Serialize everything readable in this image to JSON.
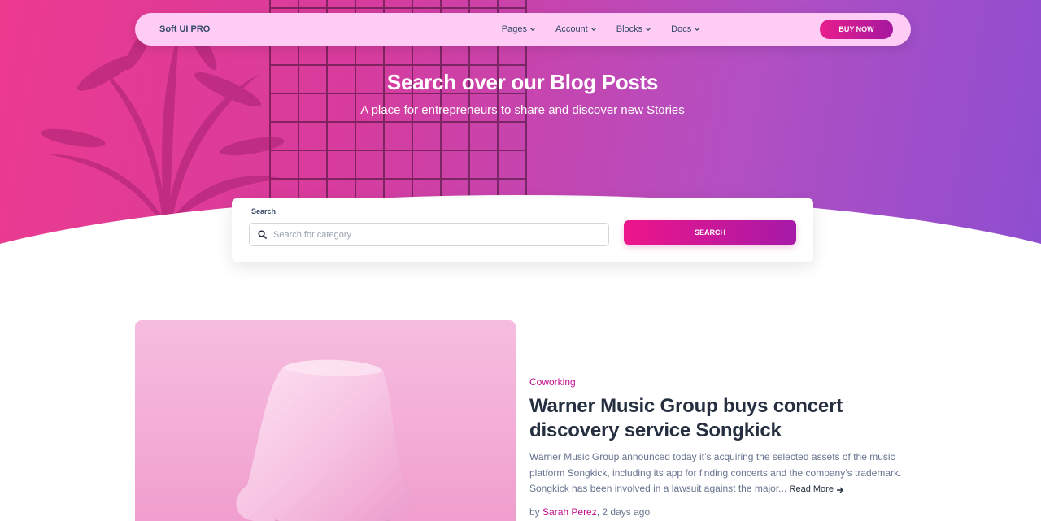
{
  "navbar": {
    "brand": "Soft UI PRO",
    "links": [
      {
        "label": "Pages"
      },
      {
        "label": "Account"
      },
      {
        "label": "Blocks"
      },
      {
        "label": "Docs"
      }
    ],
    "buy_label": "BUY NOW"
  },
  "hero": {
    "title": "Search over our Blog Posts",
    "subtitle": "A place for entrepreneurs to share and discover new Stories"
  },
  "search": {
    "label": "Search",
    "placeholder": "Search for category",
    "button_label": "SEARCH"
  },
  "post": {
    "category": "Coworking",
    "title": "Warner Music Group buys concert discovery service Songkick",
    "excerpt": "Warner Music Group announced today it’s acquiring the selected assets of the music platform Songkick, including its app for finding concerts and the company’s trademark. Songkick has been involved in a lawsuit against the major...",
    "read_more": "Read More",
    "by": "by",
    "author": "Sarah Perez",
    "time": ", 2 days ago"
  },
  "colors": {
    "accent": "#e91e8c",
    "accent_dark": "#a5179f",
    "navbar_bg": "#ffccf5",
    "category": "#c20d8a"
  },
  "icons": {
    "nav_chevron": "chevron-down-icon",
    "search": "search-icon",
    "read_more": "arrow-right-icon"
  }
}
